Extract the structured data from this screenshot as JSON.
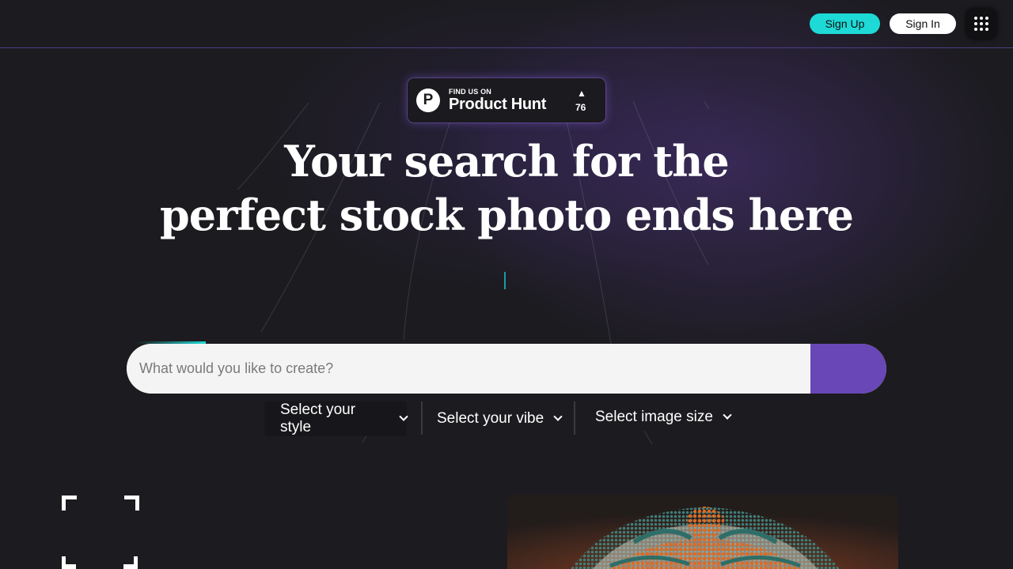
{
  "nav": {
    "signup_label": "Sign Up",
    "signin_label": "Sign In",
    "apps_icon": "grid-icon"
  },
  "badge": {
    "small_text": "FIND US ON",
    "big_text": "Product Hunt",
    "logo_letter": "P",
    "upvote_arrow": "▲",
    "count": "76"
  },
  "hero": {
    "title_line1": "Your search for the",
    "title_line2": "perfect stock photo ends here"
  },
  "search": {
    "placeholder": "What would you like to create?",
    "value": ""
  },
  "filters": {
    "style_label": "Select your style",
    "vibe_label": "Select your vibe",
    "size_label": "Select image size"
  },
  "colors": {
    "accent_teal": "#1ddad6",
    "accent_purple": "#6a47b6",
    "background": "#1c1b1f"
  },
  "gallery": {
    "frame_icon": "frame-corners-icon",
    "photo_subject": "face-painted-portrait-image"
  }
}
